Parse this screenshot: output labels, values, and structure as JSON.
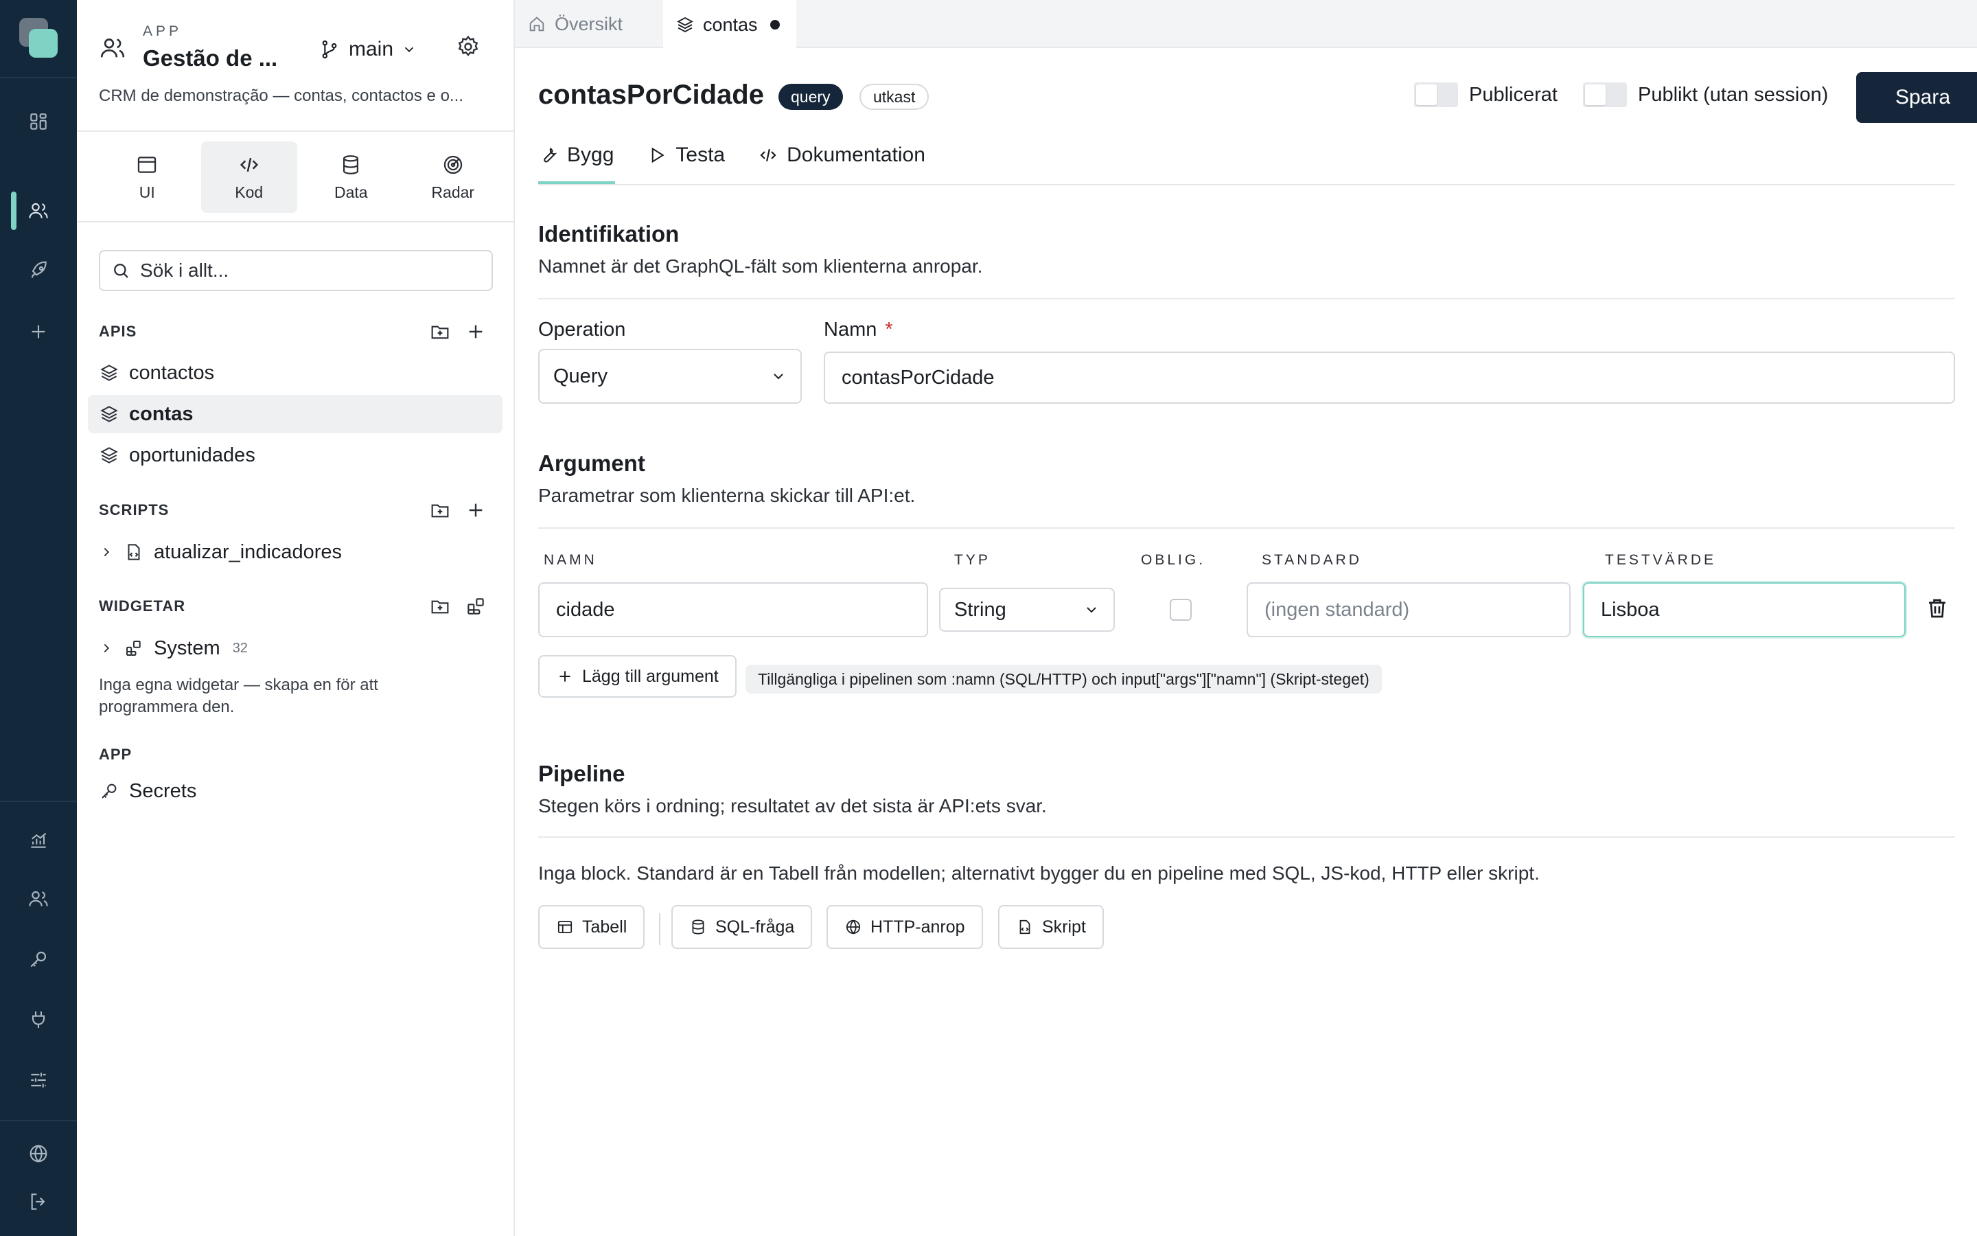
{
  "rail": {
    "icons": [
      "dashboard-icon",
      "users-icon",
      "rocket-icon",
      "plus-icon",
      "analytics-icon",
      "team-icon",
      "key-icon",
      "plug-icon",
      "sliders-icon",
      "globe-icon",
      "logout-icon"
    ],
    "accent": "#7fd3c4",
    "background": "#13283a"
  },
  "sidebar": {
    "kicker": "APP",
    "app_name": "Gestão de ...",
    "branch": "main",
    "description": "CRM de demonstração — contas, contactos e o...",
    "modes": [
      {
        "label": "UI",
        "icon": "window-icon"
      },
      {
        "label": "Kod",
        "icon": "code-icon",
        "active": true
      },
      {
        "label": "Data",
        "icon": "database-icon"
      },
      {
        "label": "Radar",
        "icon": "radar-icon"
      }
    ],
    "search_placeholder": "Sök i allt...",
    "sections": {
      "apis": {
        "title": "APIS",
        "items": [
          "contactos",
          "contas",
          "oportunidades"
        ],
        "selected": "contas"
      },
      "scripts": {
        "title": "SCRIPTS",
        "items": [
          "atualizar_indicadores"
        ]
      },
      "widgets": {
        "title": "WIDGETAR",
        "items": [
          {
            "label": "System",
            "count": "32"
          }
        ],
        "note": "Inga egna widgetar — skapa en för att programmera den."
      },
      "app": {
        "title": "APP",
        "items": [
          "Secrets"
        ]
      }
    }
  },
  "tabs": [
    {
      "label": "Översikt",
      "active": false
    },
    {
      "label": "contas",
      "active": true,
      "unsaved": true
    }
  ],
  "header": {
    "title": "contasPorCidade",
    "badge_type": "query",
    "badge_status": "utkast",
    "toggle_published": "Publicerat",
    "toggle_public": "Publikt (utan session)",
    "save_label": "Spara"
  },
  "subtabs": [
    "Bygg",
    "Testa",
    "Dokumentation"
  ],
  "identification": {
    "title": "Identifikation",
    "subtitle": "Namnet är det GraphQL-fält som klienterna anropar.",
    "operation_label": "Operation",
    "operation_value": "Query",
    "name_label": "Namn",
    "required_mark": "*",
    "name_value": "contasPorCidade"
  },
  "arguments": {
    "title": "Argument",
    "subtitle": "Parametrar som klienterna skickar till API:et.",
    "columns": [
      "NAMN",
      "TYP",
      "OBLIG.",
      "STANDARD",
      "TESTVÄRDE"
    ],
    "rows": [
      {
        "name": "cidade",
        "type": "String",
        "required": false,
        "default_placeholder": "(ingen standard)",
        "test_value": "Lisboa"
      }
    ],
    "add_label": "Lägg till argument",
    "hint": "Tillgängliga i pipelinen som :namn (SQL/HTTP) och input[\"args\"][\"namn\"] (Skript-steget)"
  },
  "pipeline": {
    "title": "Pipeline",
    "subtitle": "Stegen körs i ordning; resultatet av det sista är API:ets svar.",
    "empty_note": "Inga block. Standard är en Tabell från modellen; alternativt bygger du en pipeline med SQL, JS-kod, HTTP eller skript.",
    "blocks": [
      {
        "label": "Tabell",
        "icon": "table-icon"
      },
      {
        "label": "SQL-fråga",
        "icon": "database-icon"
      },
      {
        "label": "HTTP-anrop",
        "icon": "globe-icon"
      },
      {
        "label": "Skript",
        "icon": "script-icon"
      }
    ]
  }
}
